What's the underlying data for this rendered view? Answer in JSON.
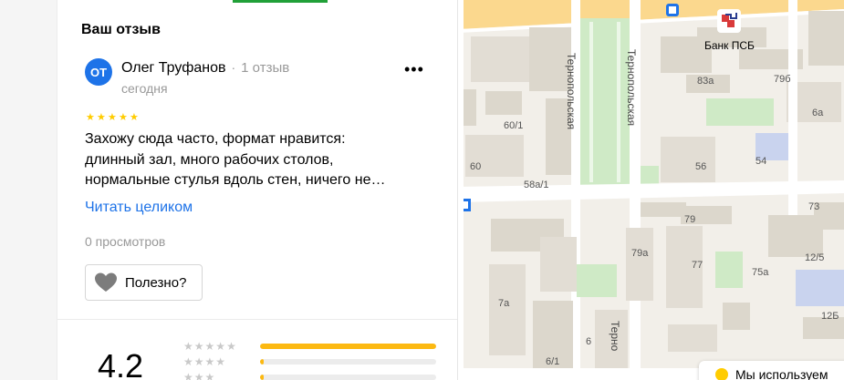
{
  "review_panel": {
    "section_title": "Ваш отзыв",
    "author": {
      "initials": "ОТ",
      "name": "Олег Труфанов",
      "review_count": "1 отзыв",
      "date": "сегодня"
    },
    "more_label": "•••",
    "rating": 5,
    "text": "Захожу сюда часто, формат нравится: длинный зал, много рабочих столов, нормальные стулья вдоль стен, ничего не…",
    "read_more": "Читать целиком",
    "views": "0 просмотров",
    "helpful_label": "Полезно?"
  },
  "summary": {
    "average": "4.2",
    "distribution": [
      {
        "stars": 5,
        "fraction": 1.0
      },
      {
        "stars": 4,
        "fraction": 0.02
      },
      {
        "stars": 3,
        "fraction": 0.02
      }
    ]
  },
  "map": {
    "bank_label": "Банк ПСБ",
    "street_labels": [
      "Тернопольская",
      "Тернопольская",
      "Тернопольская",
      "Терно"
    ],
    "house_numbers": [
      "60/1",
      "60",
      "58а/1",
      "83а",
      "79б",
      "6а",
      "56",
      "54",
      "79",
      "73",
      "79а",
      "77",
      "75а",
      "12/5",
      "7а",
      "12Б",
      "6/1",
      "6"
    ]
  },
  "cookie_notice": {
    "text": "Мы используем"
  },
  "colors": {
    "accent_green": "#21a038",
    "link_blue": "#1e73e8",
    "star_yellow": "#fc0",
    "bar_yellow": "#fcb912"
  }
}
